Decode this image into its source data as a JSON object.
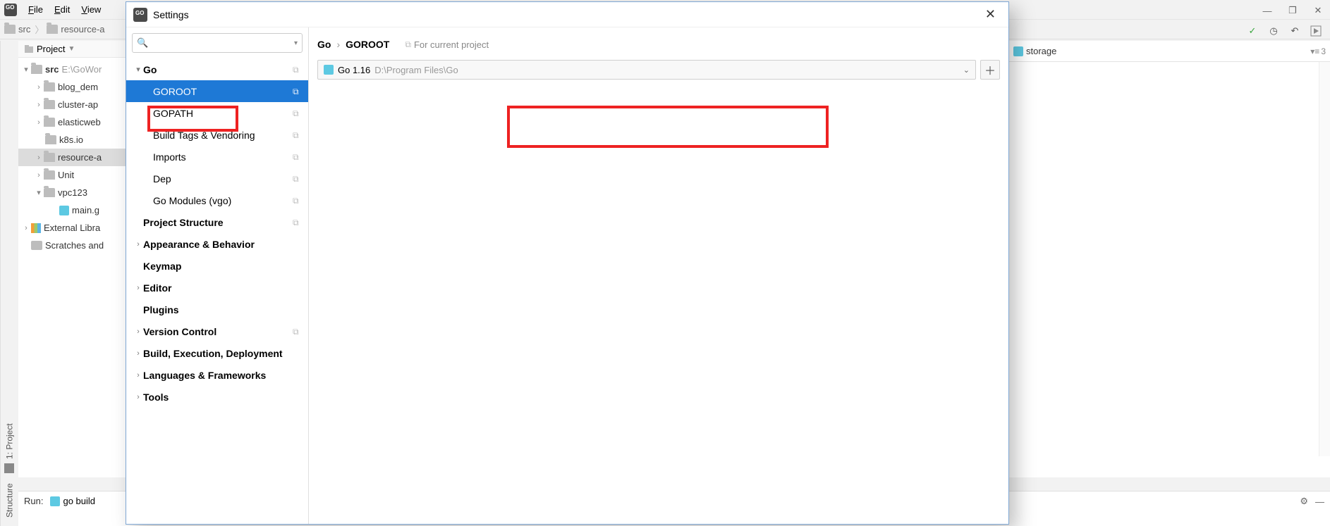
{
  "menu": {
    "file": "File",
    "edit": "Edit",
    "view": "View"
  },
  "navbar": {
    "crumb1": "src",
    "crumb2": "resource-a"
  },
  "window": {
    "min": "—",
    "max": "❐",
    "close": "✕"
  },
  "toolbar": {
    "check": "✓",
    "clock": "◷",
    "undo": "↶",
    "run": "▶"
  },
  "projectPanel": {
    "title": "Project"
  },
  "tree": {
    "root": "src",
    "rootHint": "E:\\GoWor",
    "items": [
      "blog_dem",
      "cluster-ap",
      "elasticweb",
      "k8s.io",
      "resource-a",
      "Unit",
      "vpc123"
    ],
    "file": "main.g",
    "ext": "External Libra",
    "scratch": "Scratches and"
  },
  "leftGutter": {
    "project": "1: Project",
    "structure": "Structure"
  },
  "modal": {
    "title": "Settings",
    "search_placeholder": "",
    "categories": {
      "go": "Go",
      "goroot": "GOROOT",
      "gopath": "GOPATH",
      "buildtags": "Build Tags & Vendoring",
      "imports": "Imports",
      "dep": "Dep",
      "gomodules": "Go Modules (vgo)",
      "projstruct": "Project Structure",
      "appearance": "Appearance & Behavior",
      "keymap": "Keymap",
      "editor": "Editor",
      "plugins": "Plugins",
      "vcs": "Version Control",
      "build": "Build, Execution, Deployment",
      "lang": "Languages & Frameworks",
      "tools": "Tools"
    },
    "breadcrumb": {
      "a": "Go",
      "b": "GOROOT",
      "scope": "For current project"
    },
    "goroot": {
      "version": "Go 1.16",
      "path": "D:\\Program Files\\Go"
    }
  },
  "editor": {
    "tab": "storage",
    "lines": "3",
    "lines_prefix": "▾≡"
  },
  "run": {
    "label": "Run:",
    "cfg": "go build"
  }
}
